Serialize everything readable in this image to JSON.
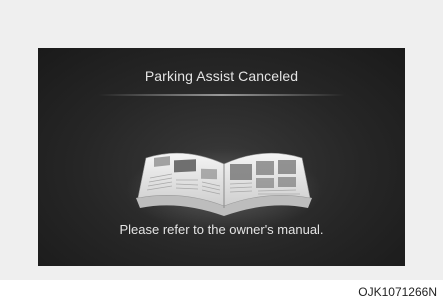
{
  "screen": {
    "title": "Parking Assist Canceled",
    "message": "Please refer to the owner's manual."
  },
  "figure_code": "OJK1071266N",
  "icons": {
    "book": "open-book-icon"
  },
  "colors": {
    "screen_bg": "#262626",
    "text": "#e4e4e4",
    "frame_bg": "#efefef"
  }
}
